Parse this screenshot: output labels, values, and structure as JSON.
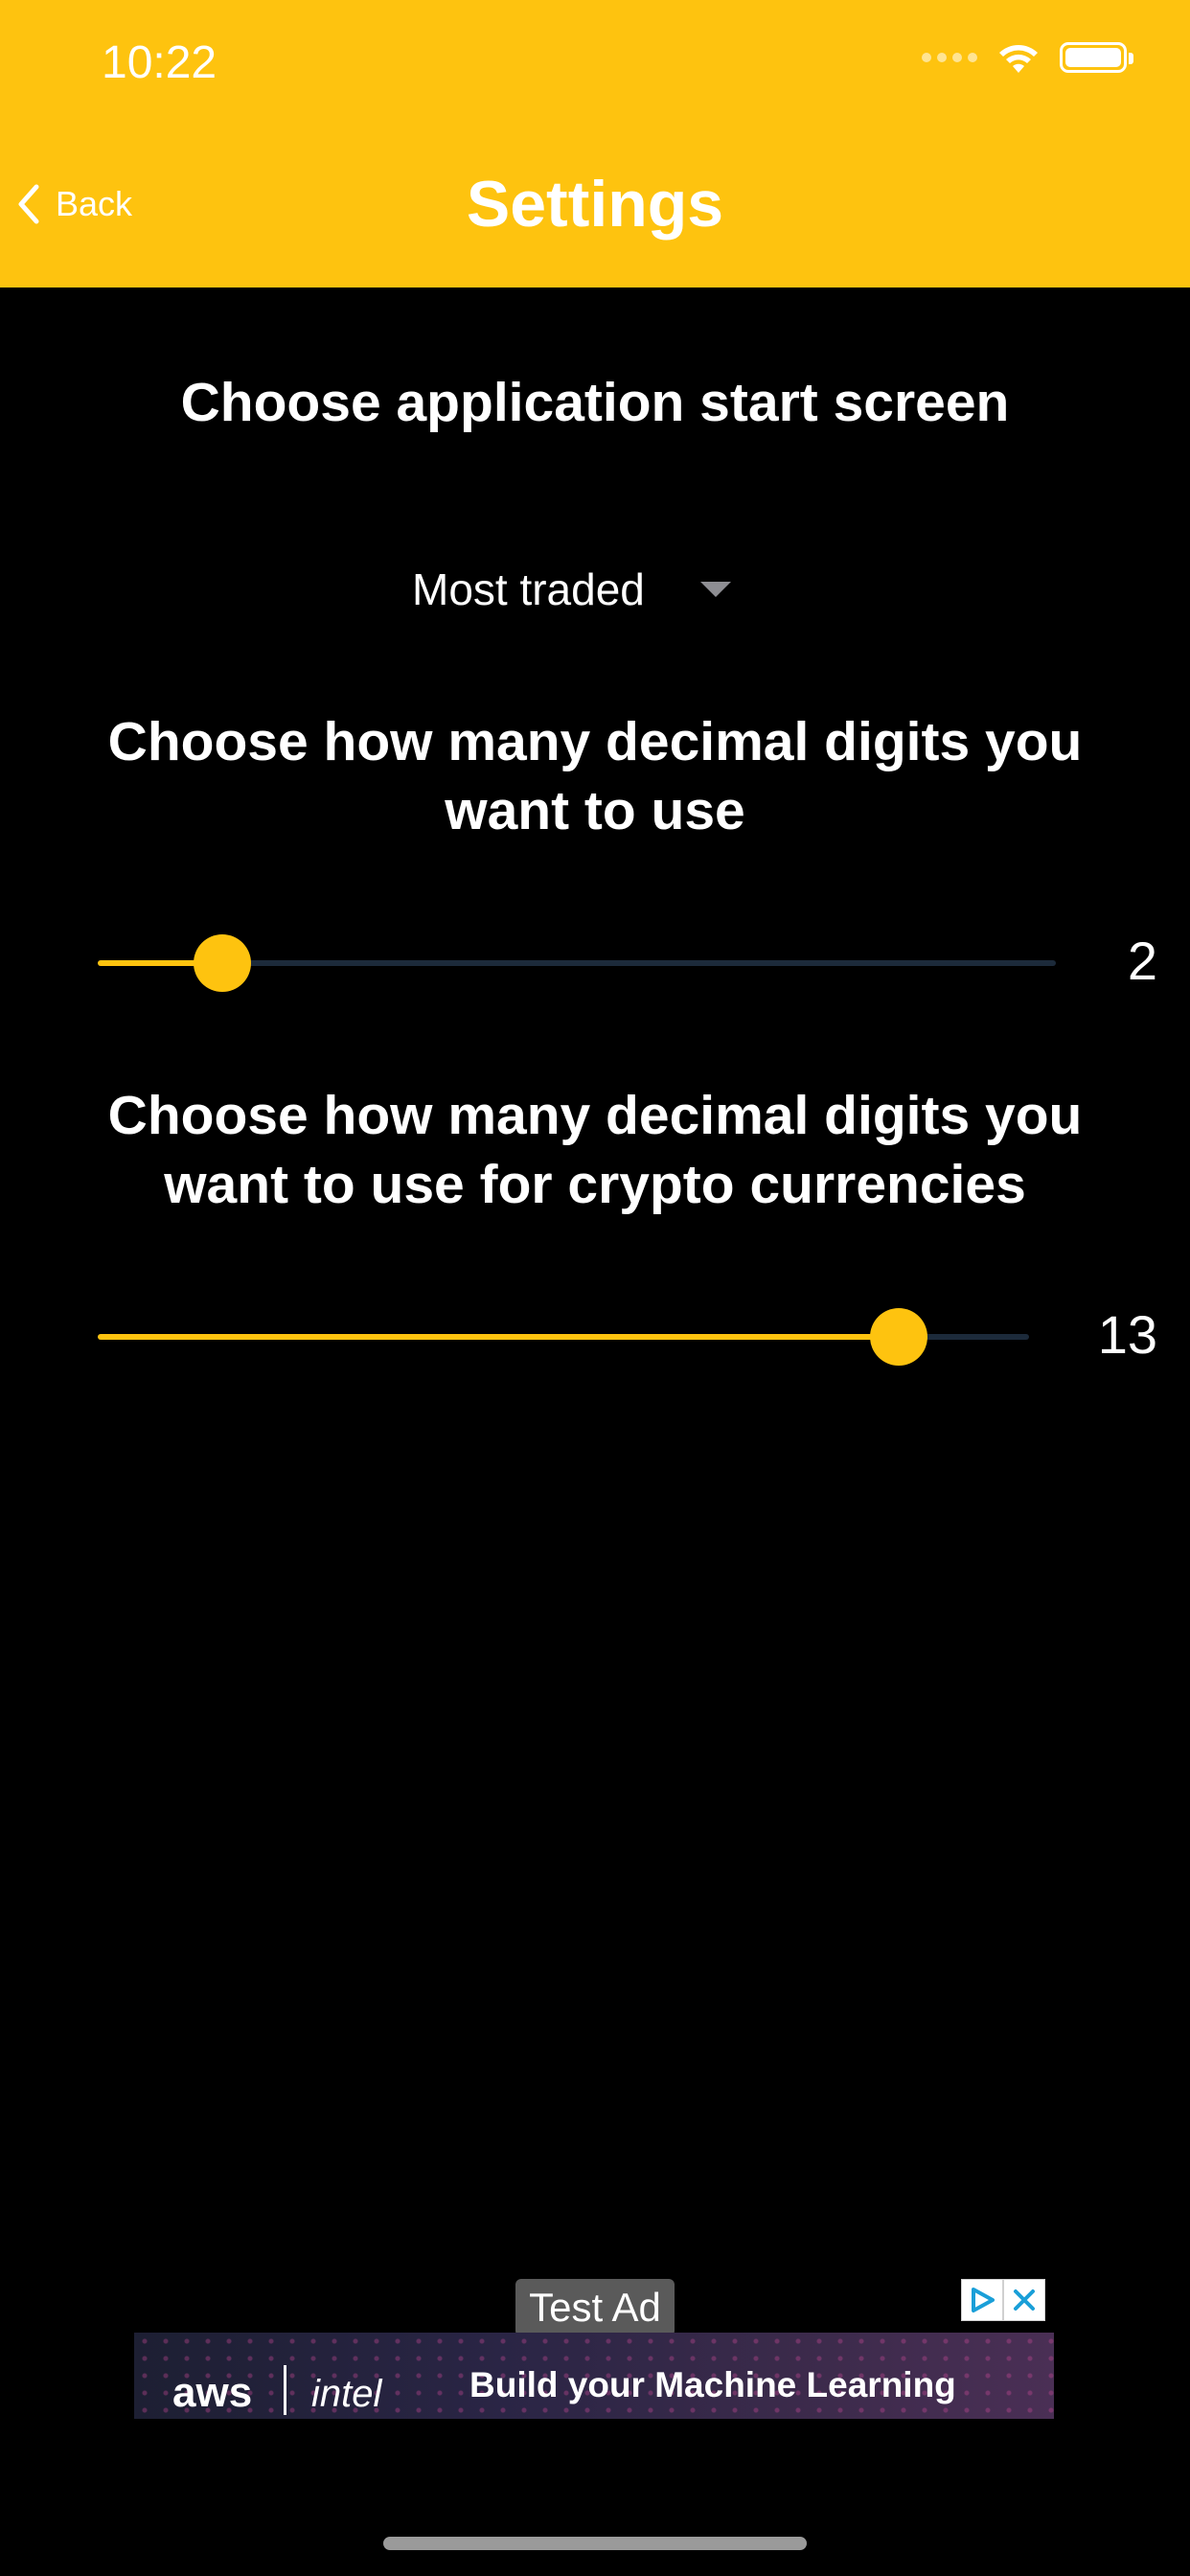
{
  "status_bar": {
    "time": "10:22"
  },
  "nav": {
    "back_label": "Back",
    "title": "Settings"
  },
  "start_screen": {
    "heading": "Choose application start screen",
    "selected": "Most traded"
  },
  "decimals": {
    "heading_line1": "Choose how many decimal digits you",
    "heading_line2": "want to use",
    "value": "2",
    "fraction": 0.13
  },
  "crypto_decimals": {
    "heading_line1": "Choose how many decimal digits you",
    "heading_line2": "want to use for crypto currencies",
    "value": "13",
    "fraction": 0.86
  },
  "ad": {
    "tag": "Test Ad",
    "brand1": "aws",
    "brand2": "intel",
    "headline": "Build your Machine Learning"
  },
  "colors": {
    "accent": "#FEC30F",
    "background": "#000000",
    "track": "#1C2A3A"
  }
}
